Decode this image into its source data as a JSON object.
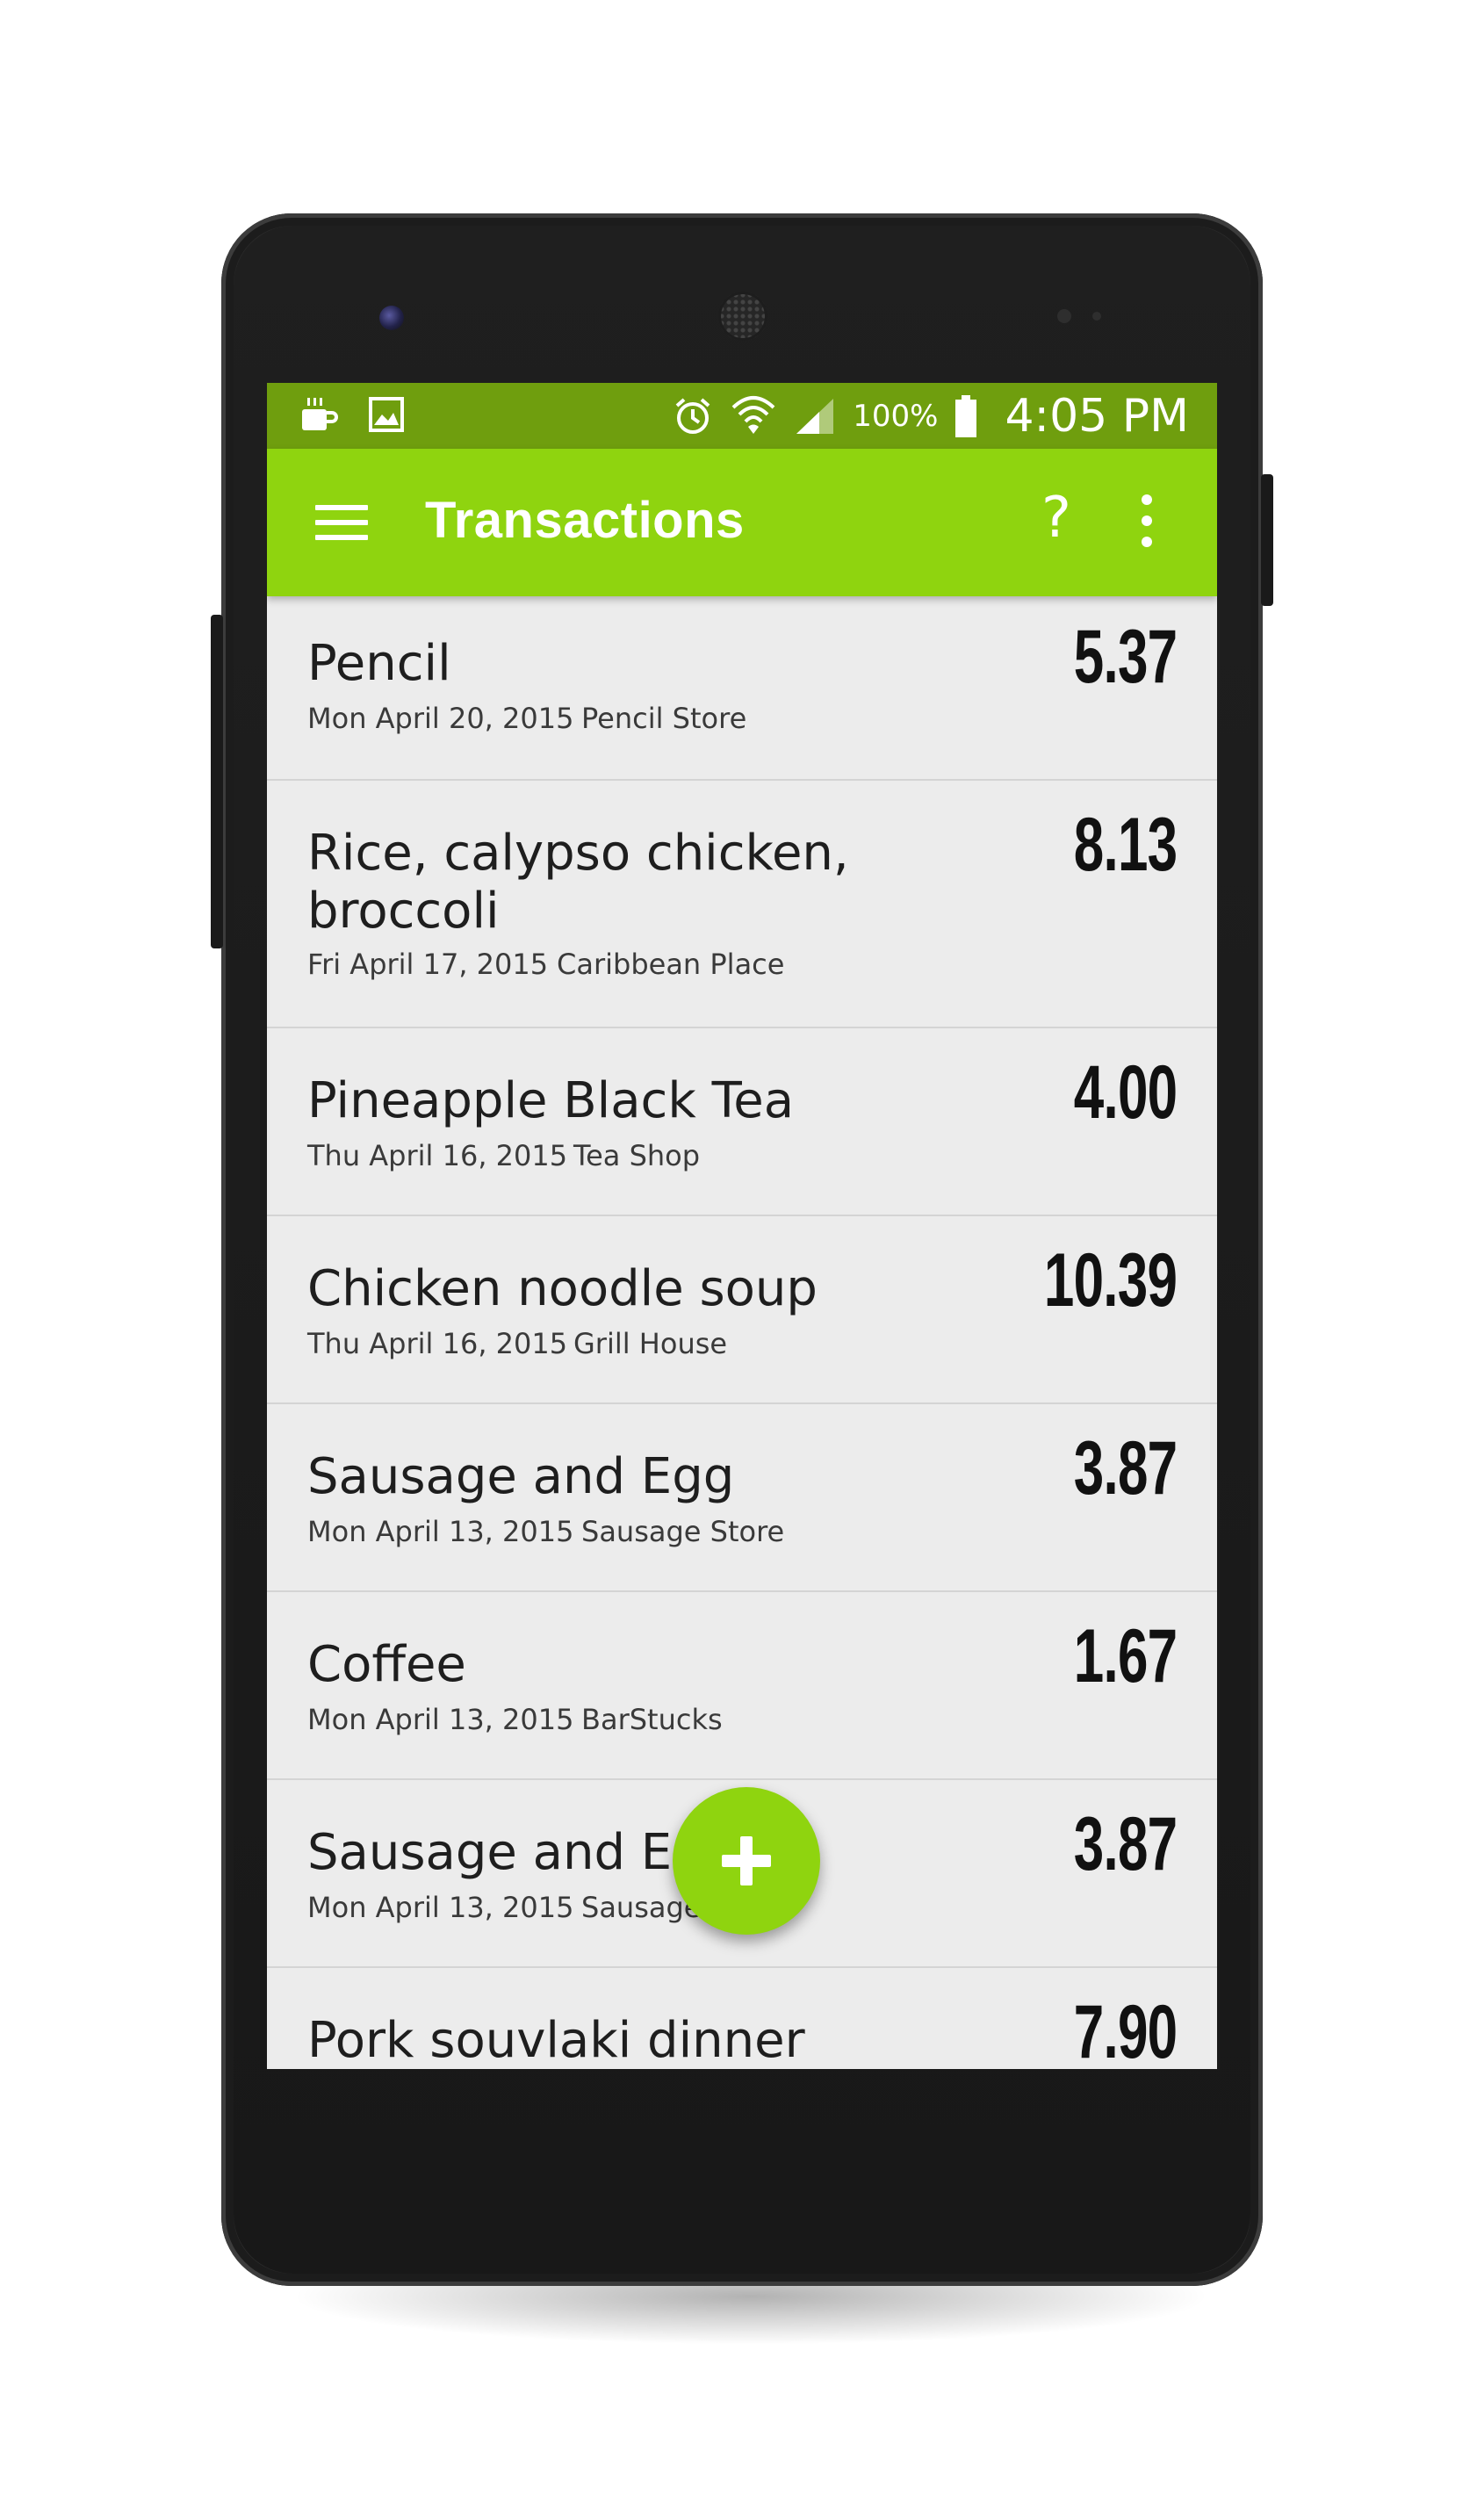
{
  "status_bar": {
    "battery_percent": "100%",
    "time": "4:05 PM",
    "icons": [
      "coffee-cup-icon",
      "image-icon",
      "alarm-icon",
      "wifi-icon",
      "signal-icon",
      "battery-icon"
    ]
  },
  "app_bar": {
    "title": "Transactions",
    "help_label": "?",
    "color": "#8fd40f",
    "status_color": "#6f9e0e"
  },
  "transactions": [
    {
      "title": "Pencil",
      "date": "Mon April 20, 2015",
      "store": "Pencil Store",
      "amount": "5.37"
    },
    {
      "title": "Rice, calypso chicken, broccoli",
      "date": "Fri April 17, 2015",
      "store": "Caribbean Place",
      "amount": "8.13"
    },
    {
      "title": "Pineapple Black Tea",
      "date": "Thu April 16, 2015",
      "store": "Tea Shop",
      "amount": "4.00"
    },
    {
      "title": "Chicken noodle soup",
      "date": "Thu April 16, 2015",
      "store": "Grill House",
      "amount": "10.39"
    },
    {
      "title": "Sausage and Egg",
      "date": "Mon April 13, 2015",
      "store": "Sausage Store",
      "amount": "3.87"
    },
    {
      "title": "Coffee",
      "date": "Mon April 13, 2015",
      "store": "BarStucks",
      "amount": "1.67"
    },
    {
      "title": "Sausage and Egg",
      "date": "Mon April 13, 2015",
      "store": "Sausage Store",
      "amount": "3.87"
    },
    {
      "title": "Pork souvlaki dinner",
      "date": "",
      "store": "",
      "amount": "7.90"
    }
  ],
  "fab": {
    "icon": "plus-icon"
  }
}
